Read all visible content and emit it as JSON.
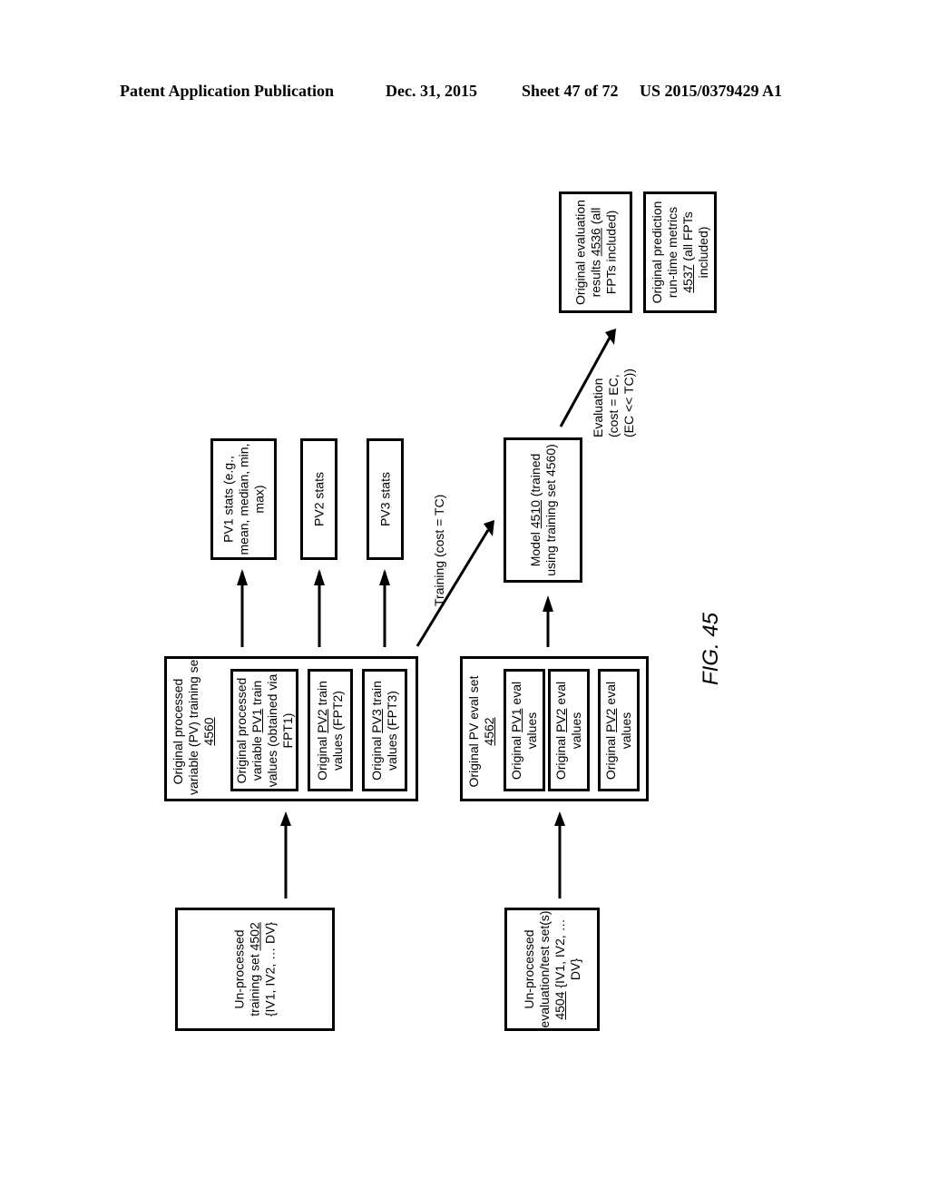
{
  "header": {
    "publication": "Patent Application Publication",
    "date": "Dec. 31, 2015",
    "sheet": "Sheet 47 of 72",
    "number": "US 2015/0379429 A1"
  },
  "figure_label": "FIG. 45",
  "boxes": {
    "unprocessed_training": {
      "line1": "Un-processed",
      "line2_pre": "training set ",
      "ref": "4502",
      "line3": "{IV1, IV2, … DV}"
    },
    "unprocessed_eval": {
      "line1": "Un-processed",
      "line2": "evaluation/test set(s)",
      "ref": "4504",
      "line3_post": " {IV1, IV2, …",
      "line4": "DV}"
    },
    "pv_training_set": {
      "line1": "Original processed",
      "line2": "variable (PV) training set",
      "ref": "4560",
      "items": [
        {
          "l1": "Original processed",
          "l2_pre": "variable ",
          "pv": "PV1",
          "l2_post": " train",
          "l3": "values (obtained via",
          "l4": "FPT1)"
        },
        {
          "l1_pre": "Original ",
          "pv": "PV2",
          "l1_post": " train",
          "l2": "values (FPT2)"
        },
        {
          "l1_pre": "Original ",
          "pv": "PV3",
          "l1_post": " train",
          "l2": "values (FPT3)"
        }
      ]
    },
    "pv_eval_set": {
      "line1": "Original PV eval set",
      "ref": "4562",
      "items": [
        {
          "l1_pre": "Original ",
          "pv": "PV1",
          "l1_post": " eval",
          "l2": "values"
        },
        {
          "l1_pre": "Original ",
          "pv": "PV2",
          "l1_post": " eval",
          "l2": "values"
        },
        {
          "l1_pre": "Original ",
          "pv": "PV2",
          "l1_post": " eval",
          "l2": "values"
        }
      ]
    },
    "stats": [
      {
        "l1": "PV1  stats (e.g.,",
        "l2": "mean, median, min,",
        "l3": "max)"
      },
      {
        "l1": "PV2 stats"
      },
      {
        "l1": "PV3 stats"
      }
    ],
    "model": {
      "l1_pre": "Model ",
      "ref": "4510",
      "l1_post": " (trained",
      "l2": "using training set 4560)"
    },
    "eval_results": {
      "l1": "Original evaluation",
      "l2_pre": "results ",
      "ref": "4536",
      "l2_post": " (all",
      "l3": "FPTs included)"
    },
    "runtime_metrics": {
      "l1": "Original prediction",
      "l2": "run-time metrics",
      "ref": "4537",
      "l3_post": " (all FPTs",
      "l4": "included)"
    }
  },
  "arrow_labels": {
    "training": "Training  (cost = TC)",
    "evaluation_l1": "Evaluation",
    "evaluation_l2": "(cost = EC,",
    "evaluation_l3": "(EC << TC))"
  }
}
